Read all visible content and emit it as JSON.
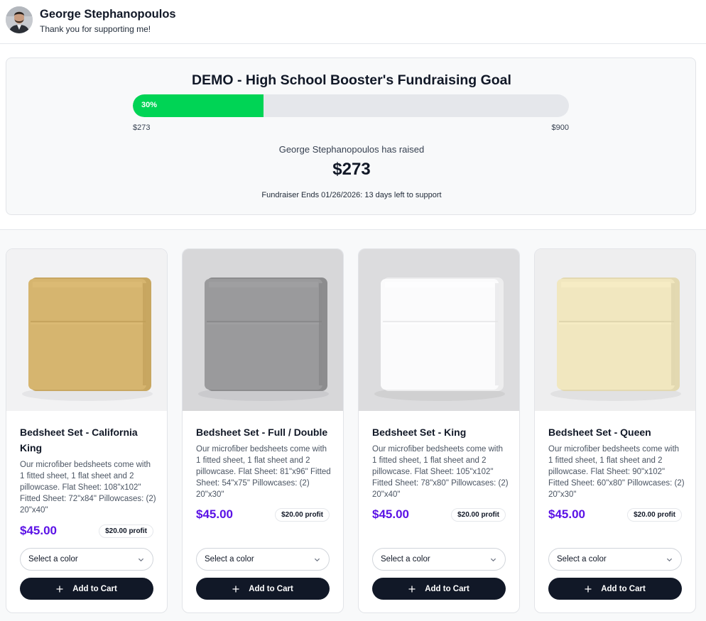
{
  "supporter": {
    "name": "George Stephanopoulos",
    "subtitle": "Thank you for supporting me!",
    "avatar_icon": "person-portrait"
  },
  "goal": {
    "title": "DEMO - High School Booster's Fundraising Goal",
    "progress_percent": 30,
    "progress_label": "30%",
    "range_min": "$273",
    "range_max": "$900",
    "raised_label": "George Stephanopoulos has raised",
    "raised_amount": "$273",
    "ends_text": "Fundraiser Ends 01/26/2026: 13 days left to support",
    "progress_color": "#00d455"
  },
  "products": [
    {
      "name": "Bedsheet Set - California King",
      "description": "Our microfiber bedsheets come with 1 fitted sheet, 1 flat sheet and 2 pillowcase. Flat Sheet: 108\"x102\" Fitted Sheet: 72\"x84\" Pillowcases: (2) 20\"x40\"",
      "price": "$45.00",
      "profit": "$20.00 profit",
      "select_placeholder": "Select a color",
      "cta_label": "Add to Cart",
      "sheet_color": "#d6b56f",
      "backdrop_color": "#f2f2f3"
    },
    {
      "name": "Bedsheet Set - Full / Double",
      "description": "Our microfiber bedsheets come with 1 fitted sheet, 1 flat sheet and 2 pillowcase. Flat Sheet: 81\"x96\" Fitted Sheet: 54\"x75\" Pillowcases: (2) 20\"x30\"",
      "price": "$45.00",
      "profit": "$20.00 profit",
      "select_placeholder": "Select a color",
      "cta_label": "Add to Cart",
      "sheet_color": "#9a9a9c",
      "backdrop_color": "#d7d7d9"
    },
    {
      "name": "Bedsheet Set - King",
      "description": "Our microfiber bedsheets come with 1 fitted sheet, 1 flat sheet and 2 pillowcase. Flat Sheet: 105\"x102\" Fitted Sheet: 78\"x80\" Pillowcases: (2) 20\"x40\"",
      "price": "$45.00",
      "profit": "$20.00 profit",
      "select_placeholder": "Select a color",
      "cta_label": "Add to Cart",
      "sheet_color": "#fbfbfc",
      "backdrop_color": "#dcdcde"
    },
    {
      "name": "Bedsheet Set - Queen",
      "description": "Our microfiber bedsheets come with 1 fitted sheet, 1 flat sheet and 2 pillowcase. Flat Sheet: 90\"x102\" Fitted Sheet: 60\"x80\" Pillowcases: (2) 20\"x30\"",
      "price": "$45.00",
      "profit": "$20.00 profit",
      "select_placeholder": "Select a color",
      "cta_label": "Add to Cart",
      "sheet_color": "#f1e7bf",
      "backdrop_color": "#eeeeef"
    }
  ],
  "colors": {
    "price": "#5b12e6",
    "button": "#111827"
  }
}
